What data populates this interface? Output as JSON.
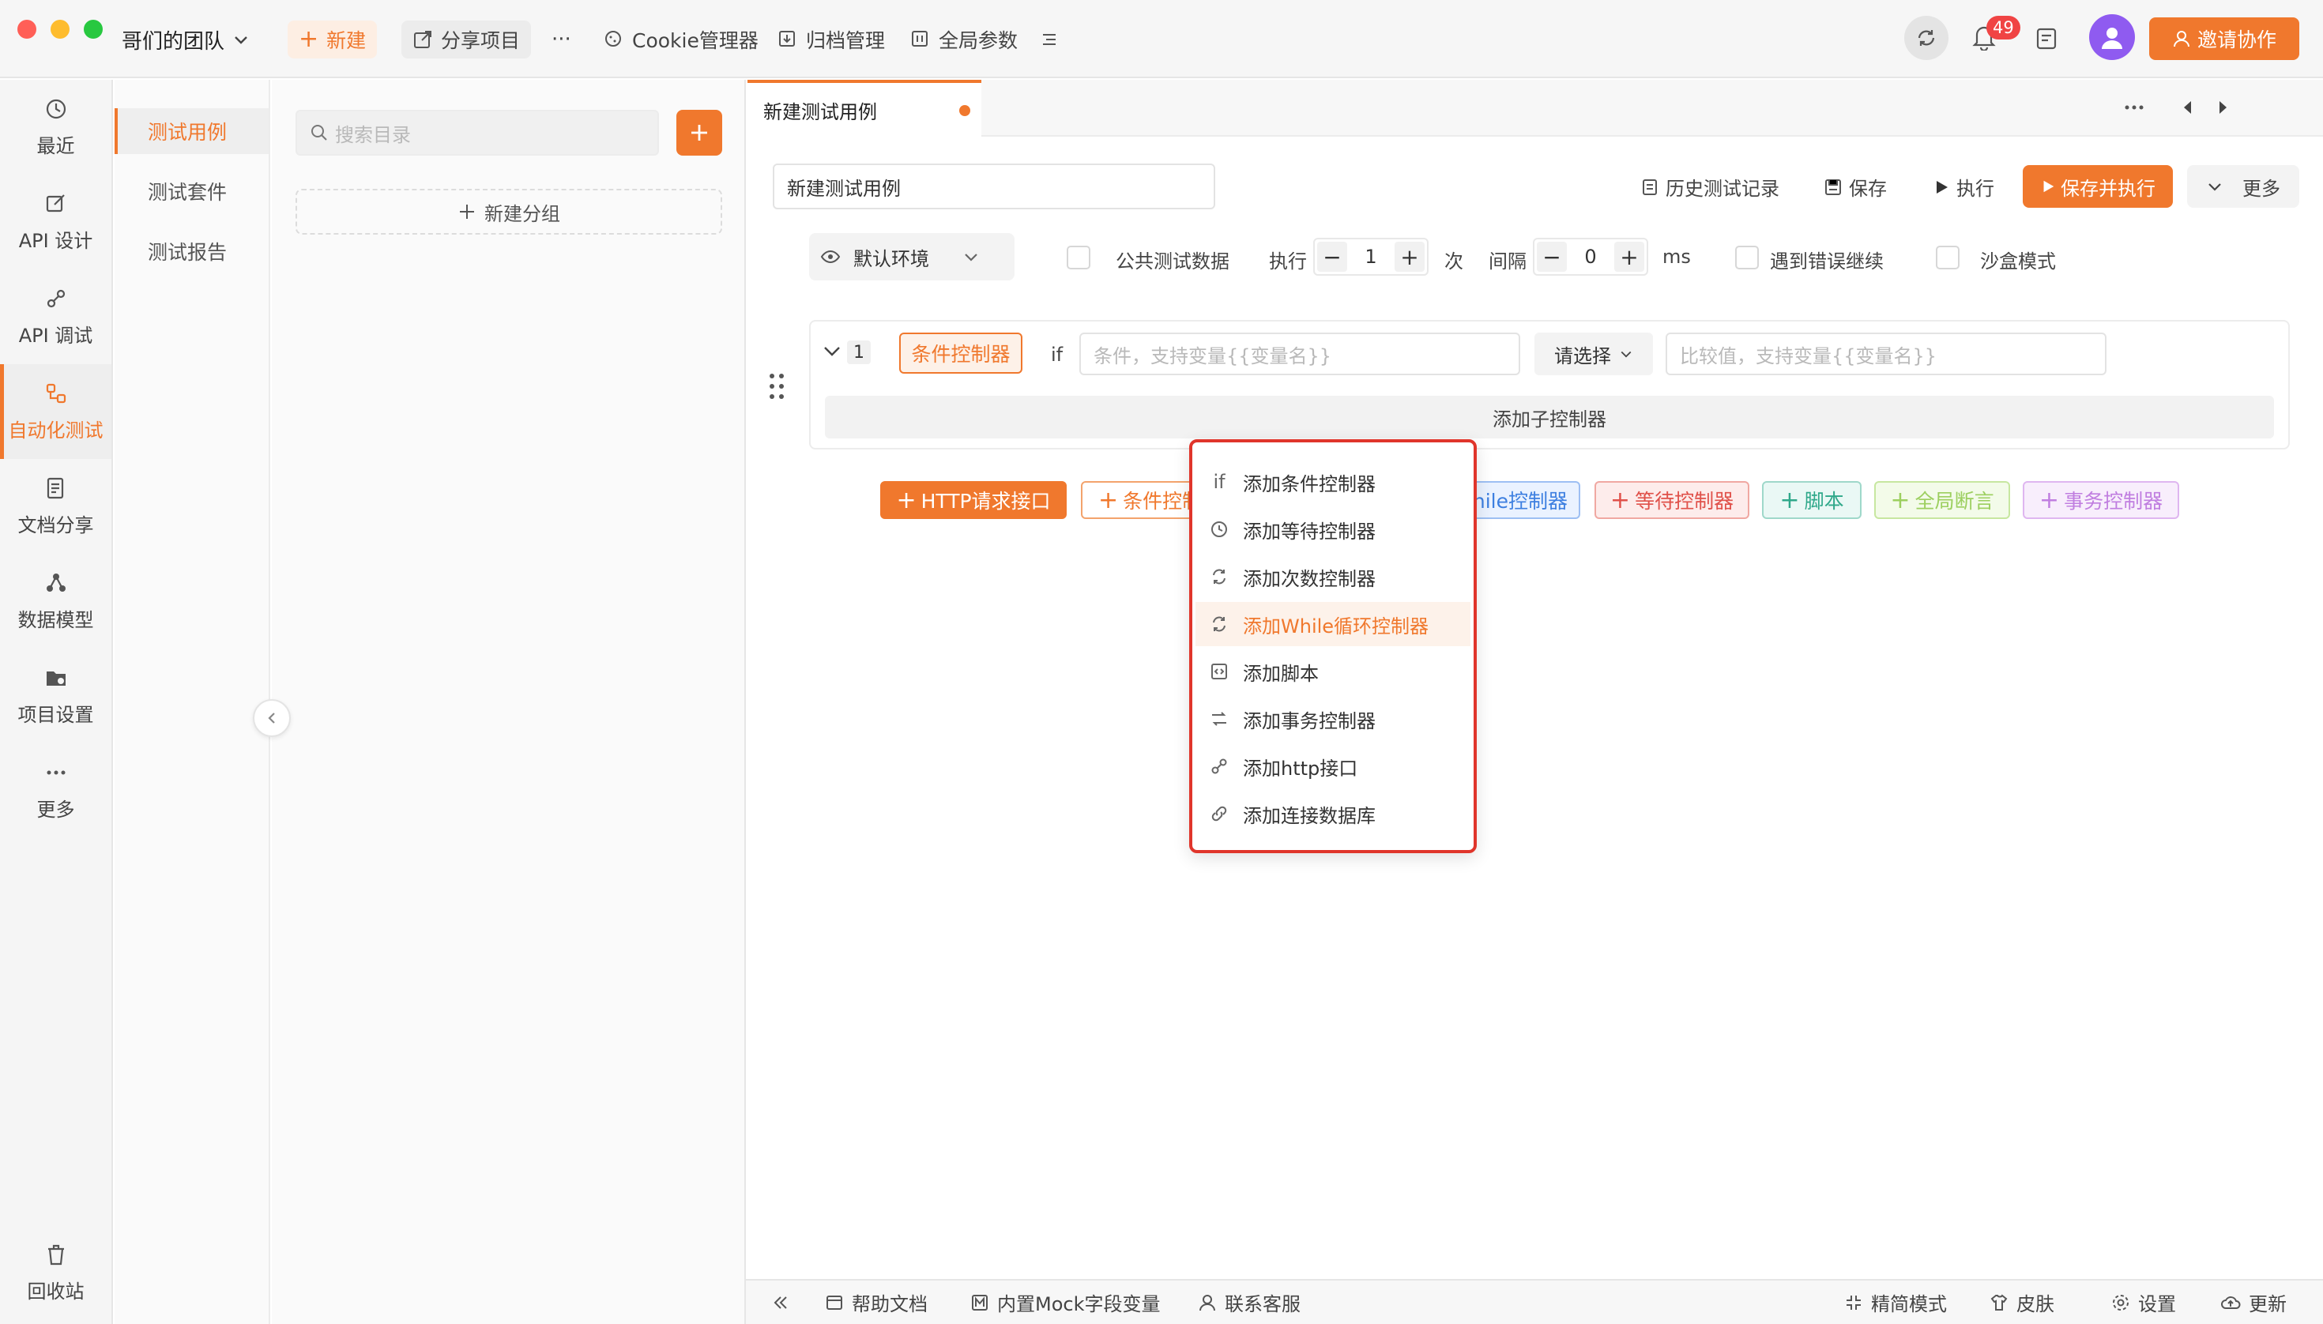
{
  "app": {
    "team_name": "哥们的团队",
    "new_label": "新建",
    "share_label": "分享项目",
    "more_dots": "···",
    "cookie_label": "Cookie管理器",
    "archive_label": "归档管理",
    "global_params_label": "全局参数",
    "notification_count": "49",
    "invite_label": "邀请协作",
    "accent_color": "#f0782d"
  },
  "rail": {
    "items": [
      {
        "label": "最近",
        "icon": "clock-icon"
      },
      {
        "label": "API 设计",
        "icon": "edit-icon"
      },
      {
        "label": "API 调试",
        "icon": "link-icon"
      },
      {
        "label": "自动化测试",
        "icon": "flow-icon"
      },
      {
        "label": "文档分享",
        "icon": "document-icon"
      },
      {
        "label": "数据模型",
        "icon": "model-icon"
      },
      {
        "label": "项目设置",
        "icon": "folder-settings-icon"
      },
      {
        "label": "更多",
        "icon": "more-icon"
      }
    ],
    "active_index": 3,
    "recycle_label": "回收站"
  },
  "subnav": {
    "items": [
      "测试用例",
      "测试套件",
      "测试报告"
    ],
    "active_index": 0
  },
  "tree": {
    "search_placeholder": "搜索目录",
    "new_group_label": "新建分组"
  },
  "tab": {
    "title": "新建测试用例"
  },
  "editor": {
    "name_value": "新建测试用例",
    "history_label": "历史测试记录",
    "save_label": "保存",
    "run_label": "执行",
    "save_run_label": "保存并执行",
    "more_label": "更多",
    "env_label": "默认环境",
    "public_data_label": "公共测试数据",
    "exec_label": "执行",
    "exec_count": "1",
    "times_unit": "次",
    "interval_label": "间隔",
    "interval_value": "0",
    "ms_unit": "ms",
    "continue_on_error_label": "遇到错误继续",
    "sandbox_label": "沙盒模式"
  },
  "step": {
    "index": "1",
    "controller_label": "条件控制器",
    "if_label": "if",
    "condition_placeholder": "条件，支持变量{{变量名}}",
    "select_label": "请选择",
    "compare_placeholder": "比较值，支持变量{{变量名}}",
    "add_child_label": "添加子控制器"
  },
  "add_buttons": {
    "http": "HTTP请求接口",
    "condition": "条件控制",
    "while": "hile控制器",
    "wait": "等待控制器",
    "script": "脚本",
    "assert": "全局断言",
    "transaction": "事务控制器"
  },
  "menu": {
    "items": [
      {
        "label": "添加条件控制器",
        "icon": "if"
      },
      {
        "label": "添加等待控制器",
        "icon": "clock-icon"
      },
      {
        "label": "添加次数控制器",
        "icon": "loop-icon"
      },
      {
        "label": "添加While循环控制器",
        "icon": "loop-icon"
      },
      {
        "label": "添加脚本",
        "icon": "code-icon"
      },
      {
        "label": "添加事务控制器",
        "icon": "transaction-icon"
      },
      {
        "label": "添加http接口",
        "icon": "link-icon"
      },
      {
        "label": "添加连接数据库",
        "icon": "chain-icon"
      }
    ],
    "highlighted_index": 3
  },
  "footer": {
    "help_label": "帮助文档",
    "mock_label": "内置Mock字段变量",
    "support_label": "联系客服",
    "simple_mode_label": "精简模式",
    "skin_label": "皮肤",
    "settings_label": "设置",
    "update_label": "更新"
  }
}
